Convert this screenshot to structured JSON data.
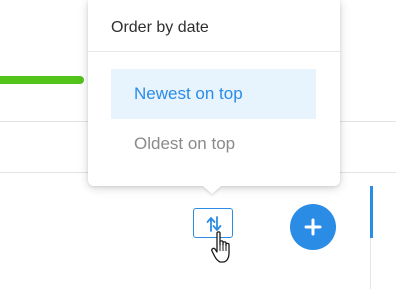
{
  "sort_menu": {
    "title": "Order by date",
    "options": [
      {
        "label": "Newest on top",
        "selected": true
      },
      {
        "label": "Oldest on top",
        "selected": false
      }
    ]
  },
  "icons": {
    "sort": "sort-arrows-icon",
    "add": "plus-icon",
    "cursor": "hand-pointer-cursor"
  },
  "colors": {
    "accent": "#2b8ce6",
    "selected_bg": "#e7f3fd",
    "progress": "#52c41a",
    "muted_text": "#8a8a8a"
  }
}
